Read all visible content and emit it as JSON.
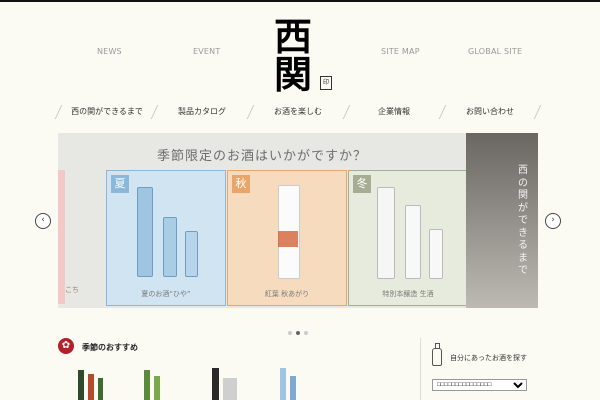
{
  "header": {
    "links": [
      "NEWS",
      "EVENT",
      "SITE MAP",
      "GLOBAL SITE"
    ],
    "logo_chars": [
      "西",
      "関"
    ],
    "logo_seal": "印"
  },
  "menu": {
    "items": [
      "西の関ができるまで",
      "製品カタログ",
      "お酒を楽しむ",
      "企業情報",
      "お問い合わせ"
    ]
  },
  "banner": {
    "title": "季節限定のお酒はいかがですか？",
    "panels": [
      {
        "tag": "",
        "caption": "ここち",
        "color": "#f2c9c7"
      },
      {
        "tag": "夏",
        "caption": "夏のお酒“ひや”",
        "color": "#8bb8d8"
      },
      {
        "tag": "秋",
        "caption": "紅葉 秋あがり",
        "color": "#e8a66a"
      },
      {
        "tag": "冬",
        "caption": "特別本醸造 生酒",
        "color": "#a7ad93"
      }
    ],
    "side_text": "西の関ができるまで"
  },
  "carousel": {
    "prev": "‹",
    "next": "›",
    "dots": 3,
    "active": 1
  },
  "recommend": {
    "title": "季節のおすすめ"
  },
  "finder": {
    "label": "自分にあったお酒を探す",
    "select_value": "□□□□□□□□□□□□□□□"
  },
  "colors": {
    "accent": "#b3202a",
    "background": "#fbfaf3"
  }
}
